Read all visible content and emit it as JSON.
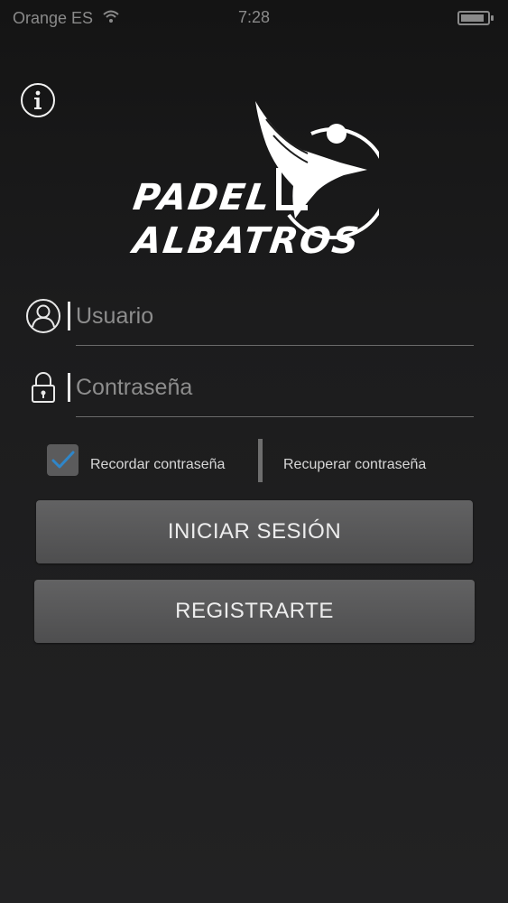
{
  "status_bar": {
    "carrier": "Orange ES",
    "time": "7:28",
    "battery_level": 0.9
  },
  "icons": {
    "info": "info-icon",
    "user": "user-icon",
    "lock": "lock-icon",
    "check": "checkmark-icon"
  },
  "logo": {
    "line1": "PADEL",
    "line2": "ALBATROS"
  },
  "login_form": {
    "username_placeholder": "Usuario",
    "password_placeholder": "Contraseña",
    "remember_label": "Recordar contraseña",
    "remember_checked": true,
    "recover_label": "Recuperar contraseña",
    "login_button": "INICIAR SESIÓN",
    "register_button": "REGISTRARTE"
  },
  "colors": {
    "background": "#1e1e1f",
    "button": "#585859",
    "checkmark": "#2f86c9",
    "text": "#d7d7d7"
  }
}
